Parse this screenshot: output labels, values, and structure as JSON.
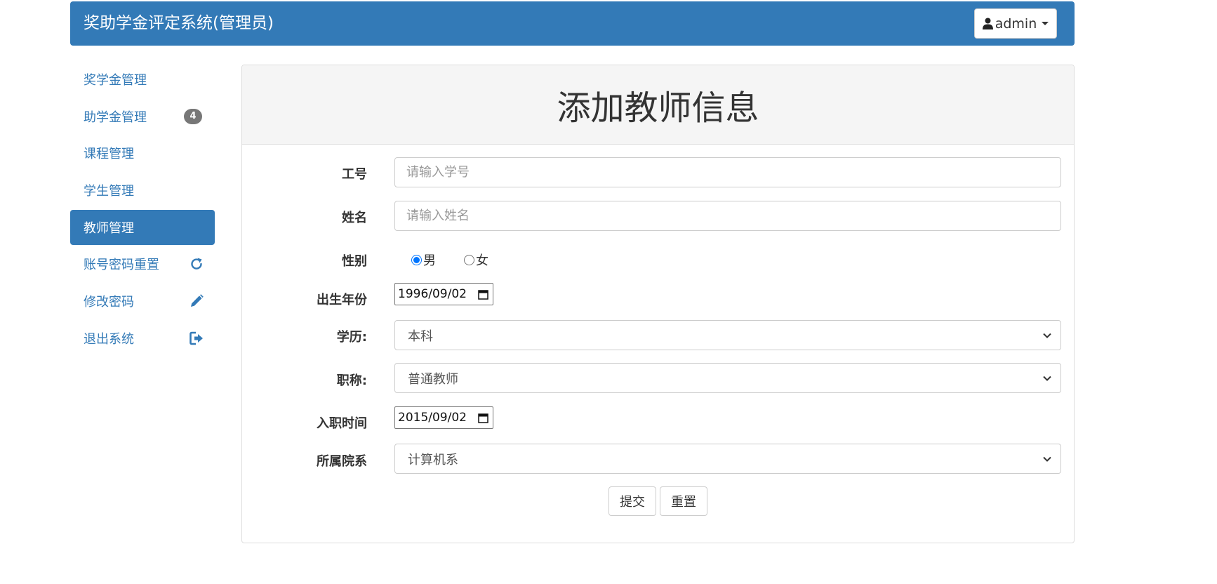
{
  "header": {
    "brand": "奖助学金评定系统(管理员)",
    "user_label": "admin",
    "user_icon": "user-icon"
  },
  "sidebar": {
    "items": [
      {
        "label": "奖学金管理"
      },
      {
        "label": "助学金管理",
        "badge": "4"
      },
      {
        "label": "课程管理"
      },
      {
        "label": "学生管理"
      },
      {
        "label": "教师管理",
        "active": true
      },
      {
        "label": "账号密码重置",
        "icon": "refresh-icon"
      },
      {
        "label": "修改密码",
        "icon": "pencil-icon"
      },
      {
        "label": "退出系统",
        "icon": "logout-icon"
      }
    ]
  },
  "form": {
    "title": "添加教师信息",
    "id_label": "工号",
    "id_placeholder": "请输入学号",
    "name_label": "姓名",
    "name_placeholder": "请输入姓名",
    "gender_label": "性别",
    "gender_male": "男",
    "gender_female": "女",
    "gender_selected": "男",
    "birth_label": "出生年份",
    "birth_value": "1996/09/02",
    "education_label": "学历:",
    "education_value": "本科",
    "title_label": "职称:",
    "title_value": "普通教师",
    "hire_label": "入职时间",
    "hire_value": "2015/09/02",
    "dept_label": "所属院系",
    "dept_value": "计算机系",
    "submit_label": "提交",
    "reset_label": "重置"
  },
  "colors": {
    "primary": "#337ab7",
    "badge": "#777777",
    "radio_checked": "#0075ff"
  }
}
